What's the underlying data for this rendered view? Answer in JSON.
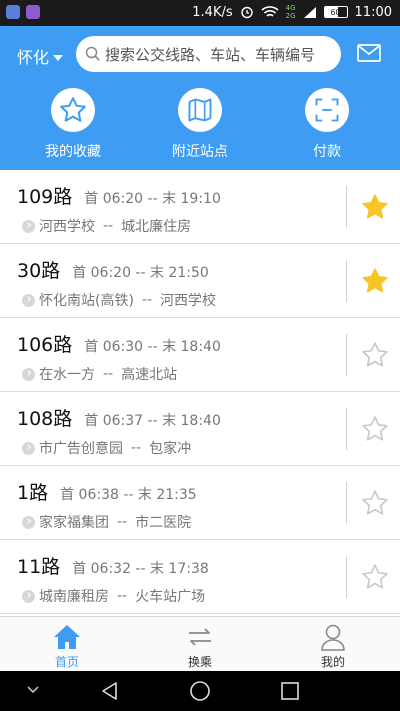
{
  "status_bar": {
    "speed": "1.4K/s",
    "network_badge_top": "4G",
    "network_badge_bottom": "2G",
    "battery": "60",
    "time": "11:00"
  },
  "header": {
    "city": "怀化",
    "search_placeholder": "搜索公交线路、车站、车辆编号"
  },
  "quick_actions": [
    {
      "label": "我的收藏",
      "icon": "star-icon"
    },
    {
      "label": "附近站点",
      "icon": "map-icon"
    },
    {
      "label": "付款",
      "icon": "scan-icon"
    }
  ],
  "routes": [
    {
      "name": "109路",
      "time": "首 06:20 -- 末 19:10",
      "from": "河西学校",
      "to": "城北廉住房",
      "starred": true
    },
    {
      "name": "30路",
      "time": "首 06:20 -- 末 21:50",
      "from": "怀化南站(高铁)",
      "to": "河西学校",
      "starred": true
    },
    {
      "name": "106路",
      "time": "首 06:30 -- 末 18:40",
      "from": "在水一方",
      "to": "高速北站",
      "starred": false
    },
    {
      "name": "108路",
      "time": "首 06:37 -- 末 18:40",
      "from": "市广告创意园",
      "to": "包家冲",
      "starred": false
    },
    {
      "name": "1路",
      "time": "首 06:38 -- 末 21:35",
      "from": "家家福集团",
      "to": "市二医院",
      "starred": false
    },
    {
      "name": "11路",
      "time": "首 06:32 -- 末 17:38",
      "from": "城南廉租房",
      "to": "火车站广场",
      "starred": false
    }
  ],
  "stop_separator": "--",
  "tabs": [
    {
      "label": "首页",
      "active": true
    },
    {
      "label": "换乘",
      "active": false
    },
    {
      "label": "我的",
      "active": false
    }
  ],
  "colors": {
    "accent": "#3e9df2",
    "star_active": "#f7c528",
    "star_inactive": "#c8c8c8"
  }
}
